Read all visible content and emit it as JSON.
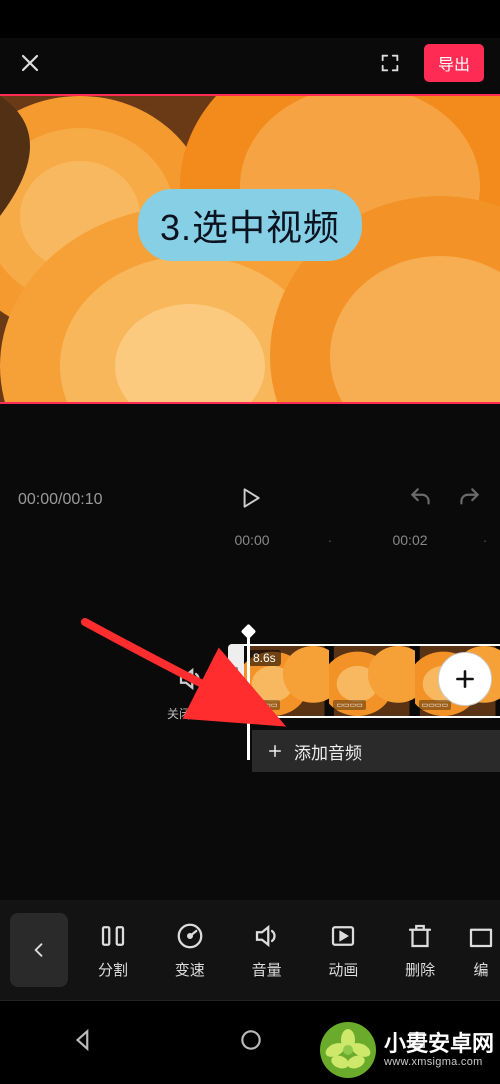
{
  "topbar": {
    "export_label": "导出"
  },
  "preview": {
    "overlay_text": "3.选中视频"
  },
  "controls": {
    "timecode": "00:00/00:10"
  },
  "ruler": {
    "t0": "00:00",
    "t1": "00:02"
  },
  "mute": {
    "label": "关闭原声"
  },
  "clip": {
    "duration": "8.6s"
  },
  "audio": {
    "add_label": "添加音频"
  },
  "tools": {
    "split": "分割",
    "speed": "变速",
    "volume": "音量",
    "anim": "动画",
    "delete": "删除",
    "edit": "编"
  },
  "watermark": {
    "zh": "小麦安卓网",
    "en": "www.xmsigma.com"
  },
  "colors": {
    "accent": "#fe2c55",
    "bubble": "#87cfe4"
  }
}
